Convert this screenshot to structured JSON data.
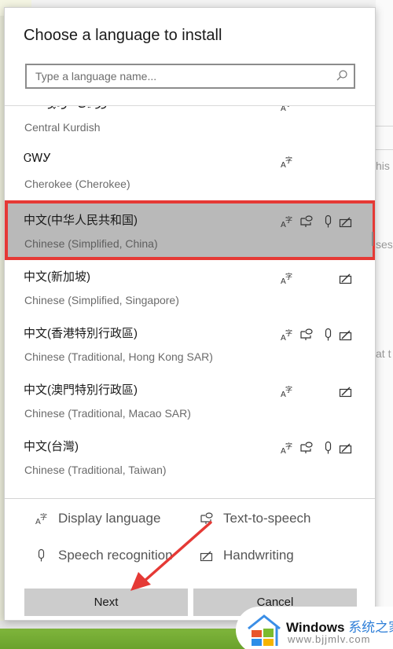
{
  "dialog": {
    "title": "Choose a language to install",
    "search": {
      "placeholder": "Type a language name...",
      "value": ""
    },
    "languages": [
      {
        "native": "کوردیی ناوەڕاست",
        "english": "Central Kurdish",
        "features": [
          "display-language"
        ],
        "selected": false
      },
      {
        "native": "ᏣᎳᎩ",
        "english": "Cherokee (Cherokee)",
        "features": [
          "display-language"
        ],
        "selected": false
      },
      {
        "native": "中文(中华人民共和国)",
        "english": "Chinese (Simplified, China)",
        "features": [
          "display-language",
          "text-to-speech",
          "speech-recognition",
          "handwriting"
        ],
        "selected": true
      },
      {
        "native": "中文(新加坡)",
        "english": "Chinese (Simplified, Singapore)",
        "features": [
          "display-language",
          "handwriting"
        ],
        "selected": false
      },
      {
        "native": "中文(香港特別行政區)",
        "english": "Chinese (Traditional, Hong Kong SAR)",
        "features": [
          "display-language",
          "text-to-speech",
          "speech-recognition",
          "handwriting"
        ],
        "selected": false
      },
      {
        "native": "中文(澳門特別行政區)",
        "english": "Chinese (Traditional, Macao SAR)",
        "features": [
          "display-language",
          "handwriting"
        ],
        "selected": false
      },
      {
        "native": "中文(台灣)",
        "english": "Chinese (Traditional, Taiwan)",
        "features": [
          "display-language",
          "text-to-speech",
          "speech-recognition",
          "handwriting"
        ],
        "selected": false
      }
    ],
    "legend": {
      "display_language": "Display language",
      "text_to_speech": "Text-to-speech",
      "speech_recognition": "Speech recognition",
      "handwriting": "Handwriting"
    },
    "buttons": {
      "next": "Next",
      "cancel": "Cancel"
    }
  },
  "background": {
    "snippets": [
      "his",
      "ses",
      "at t"
    ]
  },
  "annotation": {
    "highlight_color": "#e53935"
  },
  "watermark": {
    "brand": "Windows",
    "brand_cn": "系统之家",
    "url": "www.bjjmlv.com"
  }
}
